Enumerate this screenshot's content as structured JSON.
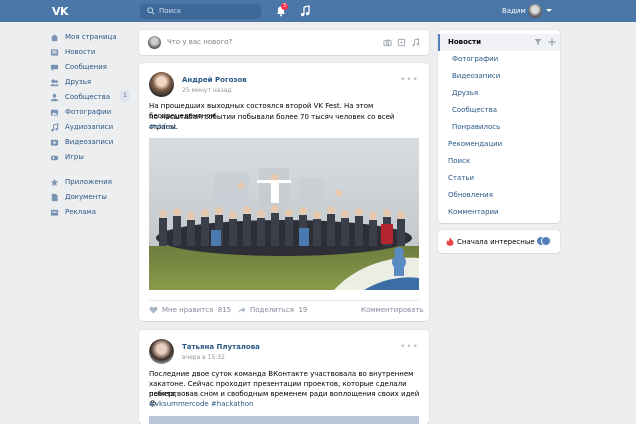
{
  "colors": {
    "header": "#4a76a8",
    "link": "#2a5885",
    "background": "#edeef0",
    "accent": "#5181b8",
    "badge": "#ff3347"
  },
  "header": {
    "logo": "VK",
    "search_placeholder": "Поиск",
    "notifications_count": "3",
    "user_name": "Вадим",
    "icons": [
      "search-icon",
      "bell-icon",
      "music-icon",
      "chevron-down-icon"
    ]
  },
  "left_menu": {
    "items": [
      {
        "label": "Моя страница",
        "icon": "home-icon"
      },
      {
        "label": "Новости",
        "icon": "news-icon"
      },
      {
        "label": "Сообщения",
        "icon": "messages-icon"
      },
      {
        "label": "Друзья",
        "icon": "friends-icon"
      },
      {
        "label": "Сообщества",
        "icon": "groups-icon",
        "count": "1"
      },
      {
        "label": "Фотографии",
        "icon": "photos-icon"
      },
      {
        "label": "Аудиозаписи",
        "icon": "audio-icon"
      },
      {
        "label": "Видеозаписи",
        "icon": "video-icon"
      },
      {
        "label": "Игры",
        "icon": "games-icon"
      }
    ],
    "extra_items": [
      {
        "label": "Приложения",
        "icon": "apps-icon"
      },
      {
        "label": "Документы",
        "icon": "documents-icon"
      },
      {
        "label": "Реклама",
        "icon": "ads-icon"
      }
    ]
  },
  "composer": {
    "placeholder": "Что у вас нового?"
  },
  "posts": [
    {
      "author": "Андрей Рогозов",
      "time": "25 минут назад",
      "text_line1": "На прошедших выходных состоялся второй VK Fest. На этом беспрецедентном",
      "text_line2": "по масштабам событии побывали более 70 тысяч человек со всей страны.",
      "tag": "#vkfest",
      "likes_label": "Мне нравится",
      "likes_count": "815",
      "shares_label": "Поделиться",
      "shares_count": "19",
      "comments_label": "Комментировать"
    },
    {
      "author": "Татьяна Плуталова",
      "time": "вчера в 15:32",
      "text_line1": "Последние двое суток команда ВКонтакте участвовала во внутреннем",
      "text_line2": "хакатоне. Сейчас проходит презентации проектов, которые сделали ребята,",
      "text_line3": "пожертвовав сном и свободным временем ради воплощения своих идей 😊",
      "tag": "#vksummercode #hackathon"
    }
  ],
  "right_menu": {
    "title": "Новости",
    "sub_items": [
      "Фотографии",
      "Видеозаписи",
      "Друзья",
      "Сообщества",
      "Понравилось"
    ],
    "items": [
      "Рекомендации",
      "Поиск",
      "Статьи",
      "Обновления",
      "Комментарии"
    ]
  },
  "filter": {
    "label": "Сначала интересные",
    "enabled": true
  }
}
